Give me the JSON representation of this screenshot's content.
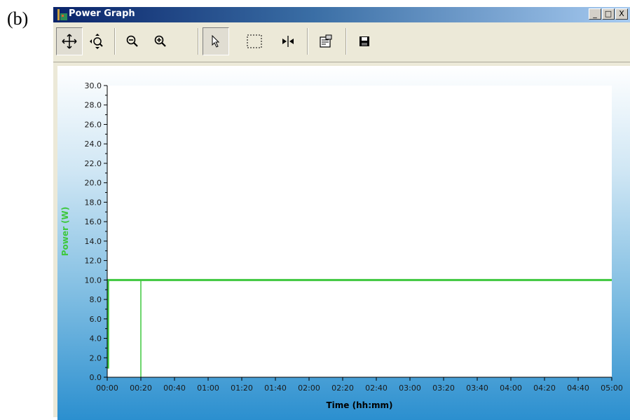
{
  "figure_label": "(b)",
  "window": {
    "title": "Power Graph",
    "buttons": {
      "minimize": "_",
      "maximize": "□",
      "close": "X"
    }
  },
  "toolbar": {
    "items": [
      {
        "name": "pan-icon",
        "pressed": true
      },
      {
        "name": "zoom-fit-icon",
        "pressed": false
      },
      {
        "name": "zoom-out-icon",
        "pressed": false
      },
      {
        "name": "zoom-in-icon",
        "pressed": false
      },
      {
        "name": "pointer-icon",
        "pressed": true
      },
      {
        "name": "select-rectangle-icon",
        "pressed": false
      },
      {
        "name": "cursor-marker-icon",
        "pressed": false
      },
      {
        "name": "properties-icon",
        "pressed": false
      },
      {
        "name": "save-icon",
        "pressed": false
      }
    ]
  },
  "colors": {
    "series": "#3ec83e",
    "axis_title_y": "#3ec83e",
    "axis_title_x": "#000000"
  },
  "chart_data": {
    "type": "line",
    "xlabel": "Time (hh:mm)",
    "ylabel": "Power (W)",
    "xlim": [
      0,
      300
    ],
    "ylim": [
      0,
      30
    ],
    "x_ticks": [
      "00:00",
      "00:20",
      "00:40",
      "01:00",
      "01:20",
      "01:40",
      "02:00",
      "02:20",
      "02:40",
      "03:00",
      "03:20",
      "03:40",
      "04:00",
      "04:20",
      "04:40",
      "05:00"
    ],
    "y_ticks": [
      "0.0",
      "2.0",
      "4.0",
      "6.0",
      "8.0",
      "10.0",
      "12.0",
      "14.0",
      "16.0",
      "18.0",
      "20.0",
      "22.0",
      "24.0",
      "26.0",
      "28.0",
      "30.0"
    ],
    "grid": false,
    "series": [
      {
        "x": [
          0,
          0.5,
          0.5,
          300
        ],
        "y": [
          1,
          1,
          10,
          10
        ]
      }
    ],
    "markers": [
      {
        "x": 20,
        "y_from": 0,
        "y_to": 10
      }
    ]
  }
}
